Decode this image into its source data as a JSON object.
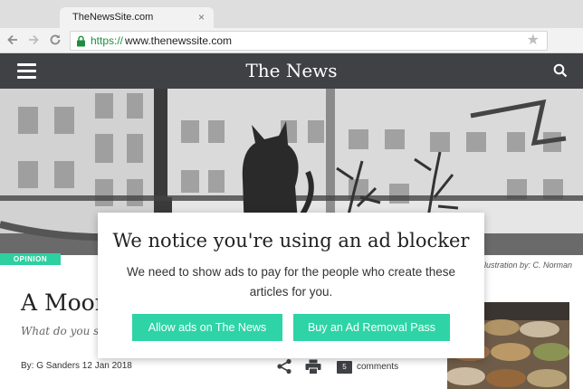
{
  "browser": {
    "tab_title": "TheNewsSite.com",
    "tab_close": "×",
    "url_scheme": "https://",
    "url_rest": "www.thenewssite.com"
  },
  "site": {
    "title": "The News"
  },
  "hero": {
    "badge": "OPINION",
    "caption": "Illustration by: C. Norman"
  },
  "article": {
    "headline": "A Moon",
    "subhead": "What do you sa",
    "byline": "By: G Sanders  12 Jan 2018",
    "comment_count": "5",
    "comment_label": "comments"
  },
  "modal": {
    "title": "We notice you're using an ad blocker",
    "body": "We need to show ads to pay for the people who create these articles for you.",
    "allow_button": "Allow ads on The News",
    "buy_button": "Buy an Ad Removal Pass"
  },
  "colors": {
    "header_bg": "#3f4144",
    "accent": "#2ed4a6",
    "https_green": "#1e8e3e"
  }
}
